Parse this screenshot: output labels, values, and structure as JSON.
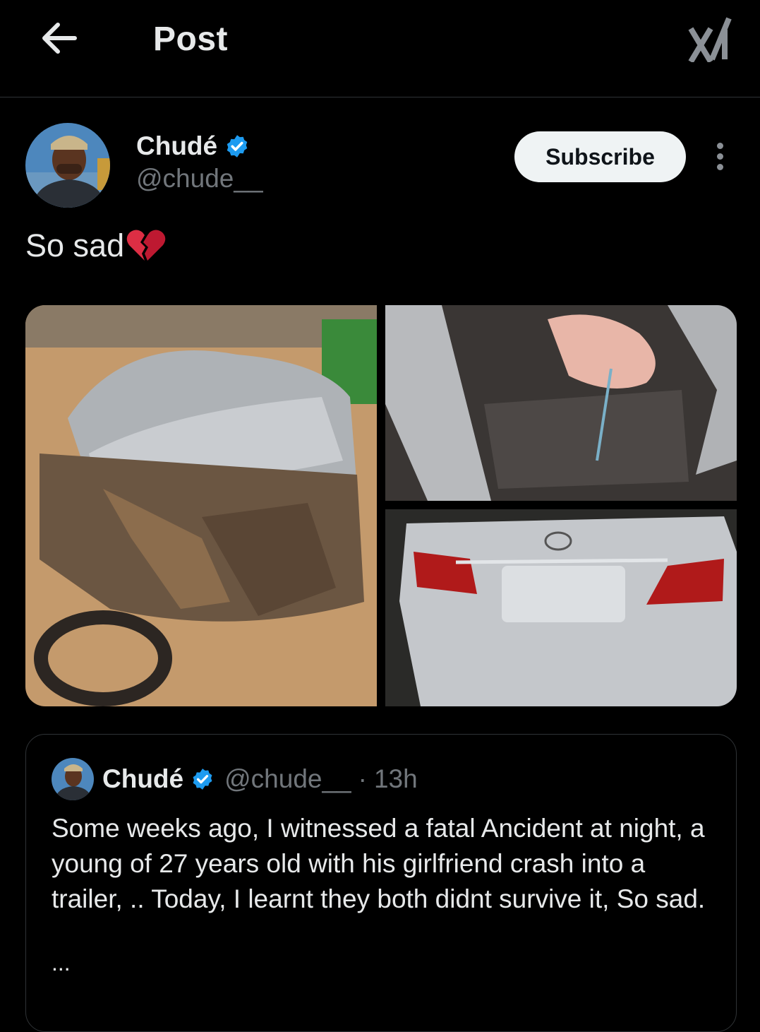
{
  "header": {
    "title": "Post",
    "back_icon": "arrow-left-icon",
    "logo_icon": "xai-grok-logo-icon"
  },
  "post": {
    "author_name": "Chudé",
    "author_handle": "@chude__",
    "subscribe_label": "Subscribe",
    "text": "So sad",
    "emoji": "broken-heart-emoji",
    "images": [
      "crashed silver car front",
      "wrecked car interior with deployed airbag",
      "Lexus rear trunk"
    ]
  },
  "quoted_post": {
    "author_name": "Chudé",
    "author_handle": "@chude__",
    "separator": "·",
    "time": "13h",
    "text": "Some weeks ago, I witnessed a fatal Ancident at night, a young of 27 years old with his girlfriend crash into a trailer, .. Today, I learnt they both didnt survive it, So sad.",
    "ellipsis": "..."
  },
  "colors": {
    "background": "#000000",
    "text_primary": "#e7e9ea",
    "text_secondary": "#71767b",
    "verified_blue": "#1d9bf0",
    "divider": "#2f3336"
  }
}
